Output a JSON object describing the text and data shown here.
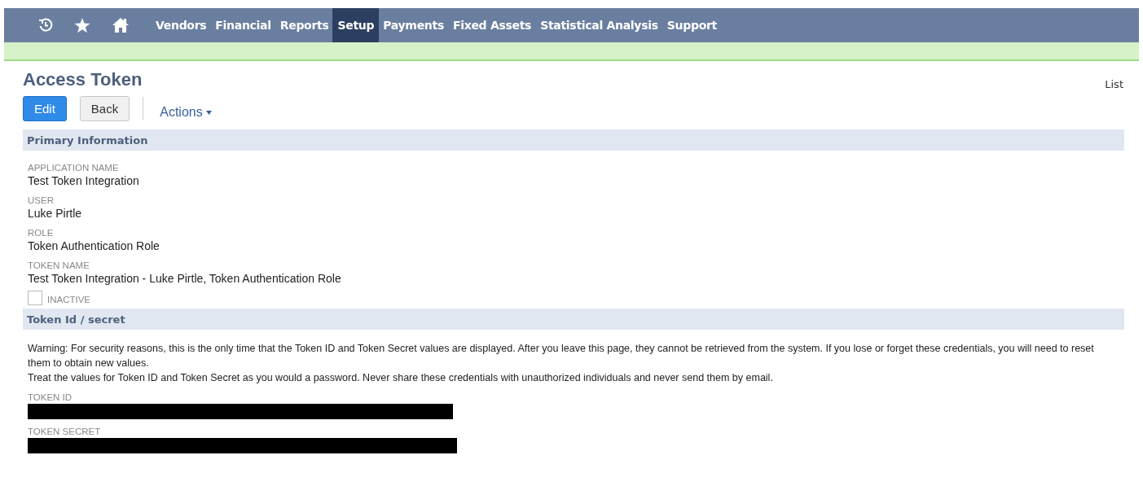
{
  "nav": {
    "icons": [
      {
        "kind": "history"
      },
      {
        "kind": "star"
      },
      {
        "kind": "home"
      }
    ],
    "items": [
      {
        "label": "Vendors",
        "selected": false
      },
      {
        "label": "Financial",
        "selected": false
      },
      {
        "label": "Reports",
        "selected": false
      },
      {
        "label": "Setup",
        "selected": true
      },
      {
        "label": "Payments",
        "selected": false
      },
      {
        "label": "Fixed Assets",
        "selected": false
      },
      {
        "label": "Statistical Analysis",
        "selected": false
      },
      {
        "label": "Support",
        "selected": false
      }
    ]
  },
  "page": {
    "title": "Access Token",
    "list_link": "List"
  },
  "buttons": [
    {
      "label": "Edit",
      "kind": "primary"
    },
    {
      "label": "Back",
      "kind": "secondary"
    }
  ],
  "actions": "Actions",
  "primary": {
    "title": "Primary Information",
    "fields": [
      {
        "label": "APPLICATION NAME",
        "value": "Test Token Integration"
      },
      {
        "label": "USER",
        "value": "Luke Pirtle"
      },
      {
        "label": "ROLE",
        "value": "Token Authentication Role"
      },
      {
        "label": "TOKEN NAME",
        "value": "Test Token Integration - Luke Pirtle, Token Authentication Role"
      }
    ],
    "inactive": {
      "label": "INACTIVE",
      "checked": false
    }
  },
  "token": {
    "title": "Token Id / secret",
    "paragraphs": [
      "Warning: For security reasons, this is the only time that the Token ID and Token Secret values are displayed. After you leave this page, they cannot be retrieved from the system. If you lose or forget these credentials, you will need to reset them to obtain new values.",
      "Treat the values for Token ID and Token Secret as you would a password. Never share these credentials with unauthorized individuals and never send them by email."
    ],
    "fields": [
      {
        "label": "TOKEN ID",
        "redacted": true
      },
      {
        "label": "TOKEN SECRET",
        "redacted": true
      }
    ]
  }
}
